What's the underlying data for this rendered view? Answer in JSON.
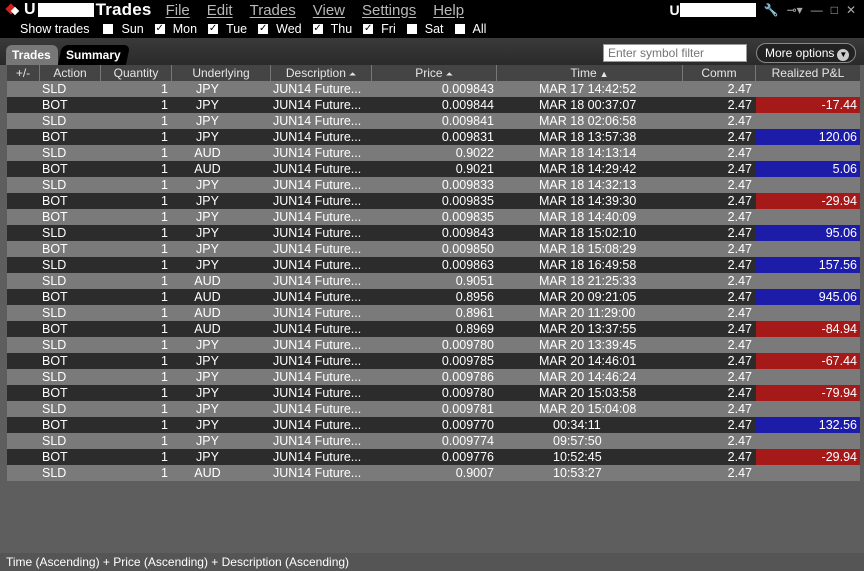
{
  "titlebar": {
    "account_prefix": "U",
    "title": "Trades",
    "menu": [
      "File",
      "Edit",
      "Trades",
      "View",
      "Settings",
      "Help"
    ],
    "right_account_prefix": "U"
  },
  "show_trades": {
    "label": "Show trades",
    "days": [
      {
        "label": "Sun",
        "checked": false
      },
      {
        "label": "Mon",
        "checked": true
      },
      {
        "label": "Tue",
        "checked": true
      },
      {
        "label": "Wed",
        "checked": true
      },
      {
        "label": "Thu",
        "checked": true
      },
      {
        "label": "Fri",
        "checked": true
      },
      {
        "label": "Sat",
        "checked": false
      },
      {
        "label": "All",
        "checked": false
      }
    ]
  },
  "tabs": [
    "Trades",
    "Summary"
  ],
  "filter": {
    "placeholder": "Enter symbol filter"
  },
  "more_options": "More options",
  "columns": [
    "+/-",
    "Action",
    "Quantity",
    "Underlying",
    "Description",
    "Price",
    "Time",
    "Comm",
    "Realized P&L"
  ],
  "rows": [
    {
      "action": "SLD",
      "qty": "1",
      "und": "JPY",
      "desc": "JUN14 Future...",
      "price": "0.009843",
      "time": "MAR 17 14:42:52",
      "comm": "2.47",
      "pnl": "",
      "pnl_sign": ""
    },
    {
      "action": "BOT",
      "qty": "1",
      "und": "JPY",
      "desc": "JUN14 Future...",
      "price": "0.009844",
      "time": "MAR 18 00:37:07",
      "comm": "2.47",
      "pnl": "-17.44",
      "pnl_sign": "neg"
    },
    {
      "action": "SLD",
      "qty": "1",
      "und": "JPY",
      "desc": "JUN14 Future...",
      "price": "0.009841",
      "time": "MAR 18 02:06:58",
      "comm": "2.47",
      "pnl": "",
      "pnl_sign": ""
    },
    {
      "action": "BOT",
      "qty": "1",
      "und": "JPY",
      "desc": "JUN14 Future...",
      "price": "0.009831",
      "time": "MAR 18 13:57:38",
      "comm": "2.47",
      "pnl": "120.06",
      "pnl_sign": "pos"
    },
    {
      "action": "SLD",
      "qty": "1",
      "und": "AUD",
      "desc": "JUN14 Future...",
      "price": "0.9022",
      "time": "MAR 18 14:13:14",
      "comm": "2.47",
      "pnl": "",
      "pnl_sign": ""
    },
    {
      "action": "BOT",
      "qty": "1",
      "und": "AUD",
      "desc": "JUN14 Future...",
      "price": "0.9021",
      "time": "MAR 18 14:29:42",
      "comm": "2.47",
      "pnl": "5.06",
      "pnl_sign": "pos"
    },
    {
      "action": "SLD",
      "qty": "1",
      "und": "JPY",
      "desc": "JUN14 Future...",
      "price": "0.009833",
      "time": "MAR 18 14:32:13",
      "comm": "2.47",
      "pnl": "",
      "pnl_sign": ""
    },
    {
      "action": "BOT",
      "qty": "1",
      "und": "JPY",
      "desc": "JUN14 Future...",
      "price": "0.009835",
      "time": "MAR 18 14:39:30",
      "comm": "2.47",
      "pnl": "-29.94",
      "pnl_sign": "neg"
    },
    {
      "action": "BOT",
      "qty": "1",
      "und": "JPY",
      "desc": "JUN14 Future...",
      "price": "0.009835",
      "time": "MAR 18 14:40:09",
      "comm": "2.47",
      "pnl": "",
      "pnl_sign": ""
    },
    {
      "action": "SLD",
      "qty": "1",
      "und": "JPY",
      "desc": "JUN14 Future...",
      "price": "0.009843",
      "time": "MAR 18 15:02:10",
      "comm": "2.47",
      "pnl": "95.06",
      "pnl_sign": "pos"
    },
    {
      "action": "BOT",
      "qty": "1",
      "und": "JPY",
      "desc": "JUN14 Future...",
      "price": "0.009850",
      "time": "MAR 18 15:08:29",
      "comm": "2.47",
      "pnl": "",
      "pnl_sign": ""
    },
    {
      "action": "SLD",
      "qty": "1",
      "und": "JPY",
      "desc": "JUN14 Future...",
      "price": "0.009863",
      "time": "MAR 18 16:49:58",
      "comm": "2.47",
      "pnl": "157.56",
      "pnl_sign": "pos"
    },
    {
      "action": "SLD",
      "qty": "1",
      "und": "AUD",
      "desc": "JUN14 Future...",
      "price": "0.9051",
      "time": "MAR 18 21:25:33",
      "comm": "2.47",
      "pnl": "",
      "pnl_sign": ""
    },
    {
      "action": "BOT",
      "qty": "1",
      "und": "AUD",
      "desc": "JUN14 Future...",
      "price": "0.8956",
      "time": "MAR 20 09:21:05",
      "comm": "2.47",
      "pnl": "945.06",
      "pnl_sign": "pos"
    },
    {
      "action": "SLD",
      "qty": "1",
      "und": "AUD",
      "desc": "JUN14 Future...",
      "price": "0.8961",
      "time": "MAR 20 11:29:00",
      "comm": "2.47",
      "pnl": "",
      "pnl_sign": ""
    },
    {
      "action": "BOT",
      "qty": "1",
      "und": "AUD",
      "desc": "JUN14 Future...",
      "price": "0.8969",
      "time": "MAR 20 13:37:55",
      "comm": "2.47",
      "pnl": "-84.94",
      "pnl_sign": "neg"
    },
    {
      "action": "SLD",
      "qty": "1",
      "und": "JPY",
      "desc": "JUN14 Future...",
      "price": "0.009780",
      "time": "MAR 20 13:39:45",
      "comm": "2.47",
      "pnl": "",
      "pnl_sign": ""
    },
    {
      "action": "BOT",
      "qty": "1",
      "und": "JPY",
      "desc": "JUN14 Future...",
      "price": "0.009785",
      "time": "MAR 20 14:46:01",
      "comm": "2.47",
      "pnl": "-67.44",
      "pnl_sign": "neg"
    },
    {
      "action": "SLD",
      "qty": "1",
      "und": "JPY",
      "desc": "JUN14 Future...",
      "price": "0.009786",
      "time": "MAR 20 14:46:24",
      "comm": "2.47",
      "pnl": "",
      "pnl_sign": ""
    },
    {
      "action": "BOT",
      "qty": "1",
      "und": "JPY",
      "desc": "JUN14 Future...",
      "price": "0.009780",
      "time": "MAR 20 15:03:58",
      "comm": "2.47",
      "pnl": "-79.94",
      "pnl_sign": "neg"
    },
    {
      "action": "SLD",
      "qty": "1",
      "und": "JPY",
      "desc": "JUN14 Future...",
      "price": "0.009781",
      "time": "MAR 20 15:04:08",
      "comm": "2.47",
      "pnl": "",
      "pnl_sign": ""
    },
    {
      "action": "BOT",
      "qty": "1",
      "und": "JPY",
      "desc": "JUN14 Future...",
      "price": "0.009770",
      "time": "00:34:11",
      "comm": "2.47",
      "pnl": "132.56",
      "pnl_sign": "pos"
    },
    {
      "action": "SLD",
      "qty": "1",
      "und": "JPY",
      "desc": "JUN14 Future...",
      "price": "0.009774",
      "time": "09:57:50",
      "comm": "2.47",
      "pnl": "",
      "pnl_sign": ""
    },
    {
      "action": "BOT",
      "qty": "1",
      "und": "JPY",
      "desc": "JUN14 Future...",
      "price": "0.009776",
      "time": "10:52:45",
      "comm": "2.47",
      "pnl": "-29.94",
      "pnl_sign": "neg"
    },
    {
      "action": "SLD",
      "qty": "1",
      "und": "AUD",
      "desc": "JUN14 Future...",
      "price": "0.9007",
      "time": "10:53:27",
      "comm": "2.47",
      "pnl": "",
      "pnl_sign": ""
    }
  ],
  "status_bar": "Time (Ascending)  +  Price (Ascending)  +  Description (Ascending)",
  "colors": {
    "pnl_negative": "#a51919",
    "pnl_positive": "#1c1ca8",
    "row_light": "#7a7a7a",
    "row_dark": "#2c2c2c"
  }
}
